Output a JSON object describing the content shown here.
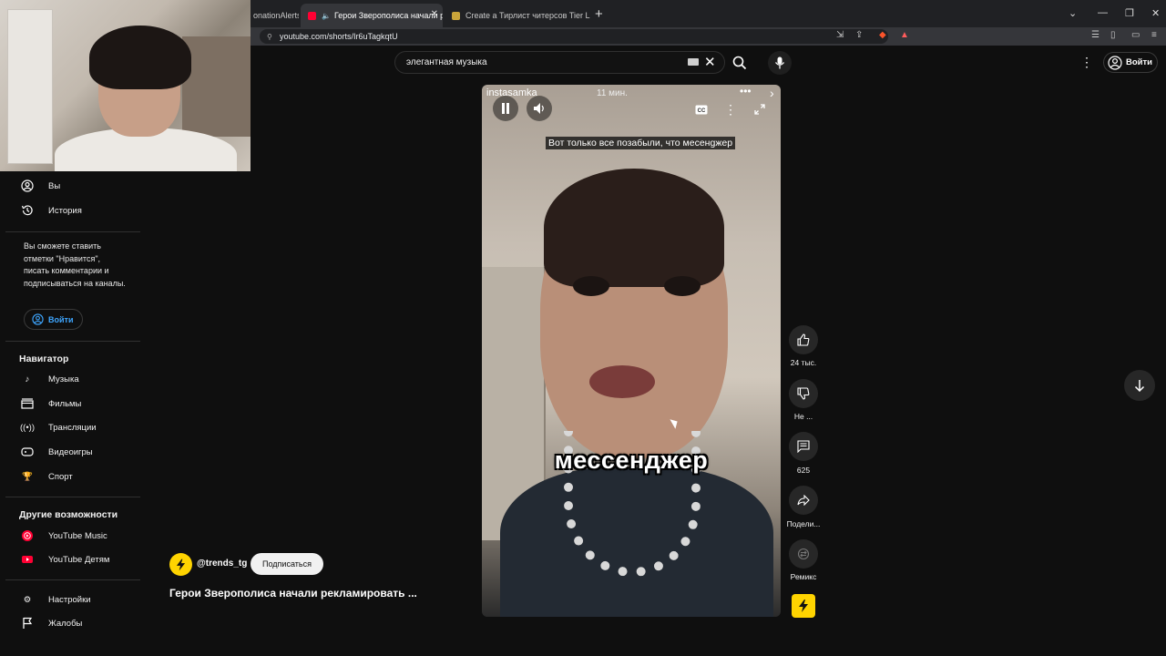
{
  "browser": {
    "tabs": [
      {
        "label": "onationAlerts"
      },
      {
        "label": "Герои Зверополиса начали р"
      },
      {
        "label": "Create a Тирлист читерсов Tier List -"
      }
    ],
    "url": "youtube.com/shorts/Ir6uTagkqtU"
  },
  "search": {
    "value": "элегантная музыка"
  },
  "header": {
    "signin": "Войти"
  },
  "sidebar": {
    "you": "Вы",
    "history": "История",
    "signin_text": "Вы сможете ставить отметки \"Нравится\", писать комментарии и подписываться на каналы.",
    "signin_button": "Войти",
    "nav_heading": "Навигатор",
    "nav": [
      "Музыка",
      "Фильмы",
      "Трансляции",
      "Видеоигры",
      "Спорт"
    ],
    "more_heading": "Другие возможности",
    "more": [
      "YouTube Music",
      "YouTube Детям"
    ],
    "settings": "Настройки",
    "report": "Жалобы"
  },
  "video": {
    "overlay_channel": "instasamka",
    "overlay_time": "11 мин.",
    "caption": "Вот только все позабыли, что месенgжер",
    "big_text": "мессенджер",
    "channel": "@trends_tg",
    "subscribe": "Подписаться",
    "title": "Герои Зверополиса начали рекламировать ..."
  },
  "actions": {
    "likes": "24 тыс.",
    "dislike": "Не ...",
    "comments": "625",
    "share": "Подели...",
    "remix": "Ремикс"
  },
  "colors": {
    "accent": "#3ea6ff",
    "youtube_red": "#ff0033",
    "shorts_yellow": "#ffd400"
  }
}
